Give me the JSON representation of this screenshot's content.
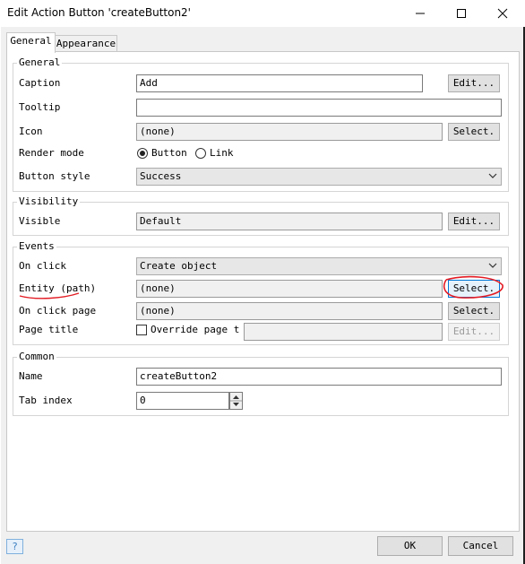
{
  "window": {
    "title": "Edit Action Button 'createButton2'"
  },
  "tabs": [
    {
      "label": "General"
    },
    {
      "label": "Appearance"
    }
  ],
  "general": {
    "title": "General",
    "caption": {
      "label": "Caption",
      "value": "Add",
      "button": "Edit..."
    },
    "tooltip": {
      "label": "Tooltip",
      "value": ""
    },
    "icon": {
      "label": "Icon",
      "value": "(none)",
      "button": "Select."
    },
    "render_mode": {
      "label": "Render mode",
      "options": [
        "Button",
        "Link"
      ],
      "selected": "Button"
    },
    "button_style": {
      "label": "Button style",
      "value": "Success"
    }
  },
  "visibility": {
    "title": "Visibility",
    "visible": {
      "label": "Visible",
      "value": "Default",
      "button": "Edit..."
    }
  },
  "events": {
    "title": "Events",
    "on_click": {
      "label": "On click",
      "value": "Create object"
    },
    "entity": {
      "label": "Entity (path)",
      "value": "(none)",
      "button": "Select."
    },
    "on_click_page": {
      "label": "On click page",
      "value": "(none)",
      "button": "Select."
    },
    "page_title": {
      "label": "Page title",
      "checkbox": "Override page t",
      "button": "Edit..."
    }
  },
  "common": {
    "title": "Common",
    "name": {
      "label": "Name",
      "value": "createButton2"
    },
    "tab_index": {
      "label": "Tab index",
      "value": "0"
    }
  },
  "footer": {
    "help": "?",
    "ok": "OK",
    "cancel": "Cancel"
  },
  "colors": {
    "annotation": "#e31b23",
    "focus": "#0078d7"
  }
}
